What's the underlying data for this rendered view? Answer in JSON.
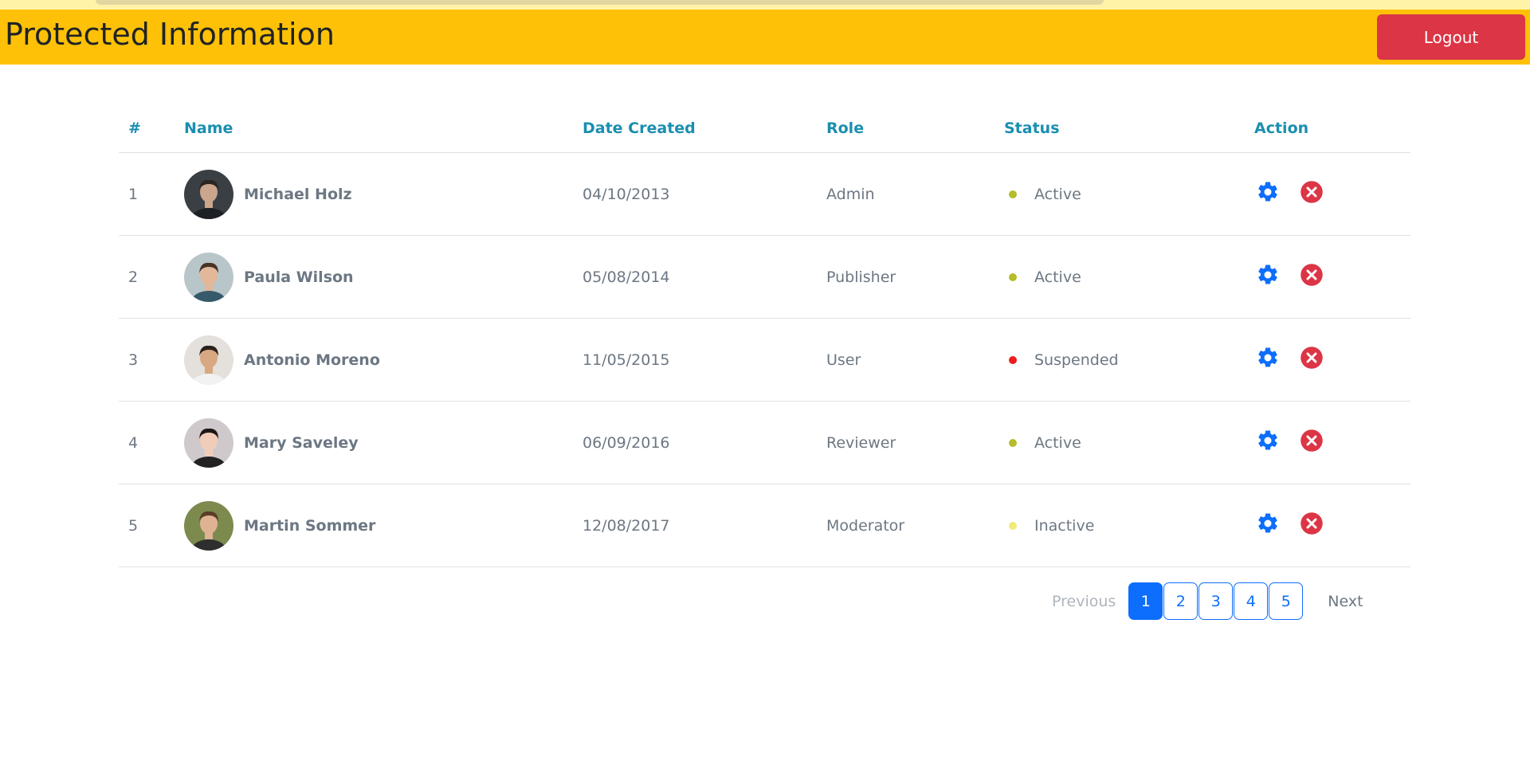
{
  "header": {
    "title": "Protected Information",
    "logout_label": "Logout"
  },
  "table": {
    "columns": [
      "#",
      "Name",
      "Date Created",
      "Role",
      "Status",
      "Action"
    ],
    "rows": [
      {
        "num": "1",
        "name": "Michael Holz",
        "date": "04/10/2013",
        "role": "Admin",
        "status": "Active",
        "status_color": "#b5bd2a"
      },
      {
        "num": "2",
        "name": "Paula Wilson",
        "date": "05/08/2014",
        "role": "Publisher",
        "status": "Active",
        "status_color": "#b5bd2a"
      },
      {
        "num": "3",
        "name": "Antonio Moreno",
        "date": "11/05/2015",
        "role": "User",
        "status": "Suspended",
        "status_color": "#ee1c1c"
      },
      {
        "num": "4",
        "name": "Mary Saveley",
        "date": "06/09/2016",
        "role": "Reviewer",
        "status": "Active",
        "status_color": "#b5bd2a"
      },
      {
        "num": "5",
        "name": "Martin Sommer",
        "date": "12/08/2017",
        "role": "Moderator",
        "status": "Inactive",
        "status_color": "#f0ea78"
      }
    ],
    "actions": {
      "settings_icon": "gear-icon",
      "settings_color": "#0d6efd",
      "delete_icon": "circle-x-icon",
      "delete_color": "#dc3545"
    }
  },
  "pagination": {
    "previous_label": "Previous",
    "next_label": "Next",
    "pages": [
      "1",
      "2",
      "3",
      "4",
      "5"
    ],
    "active_page": "1"
  },
  "colors": {
    "header_bg": "#ffc107",
    "logout_bg": "#dc3545",
    "column_header": "#1a8fb0",
    "accent": "#0d6efd"
  }
}
